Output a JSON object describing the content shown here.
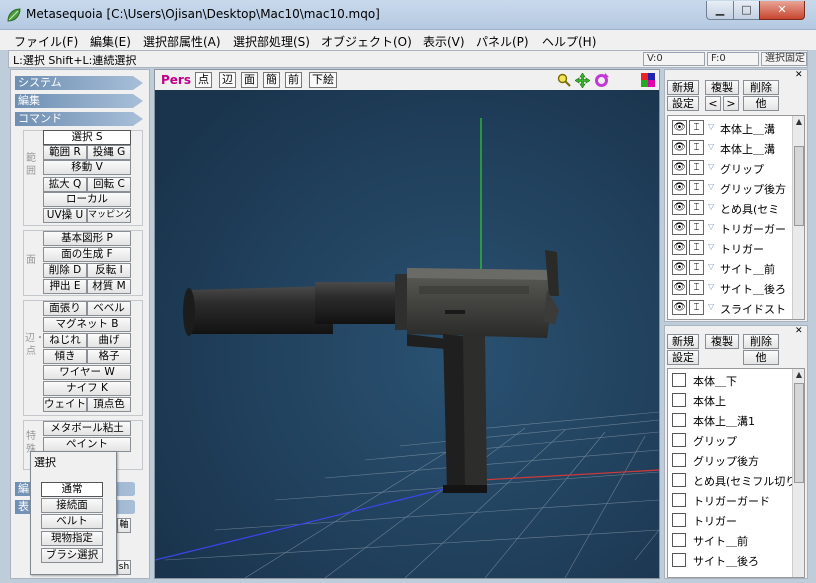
{
  "window": {
    "title": "Metasequoia [C:\\Users\\Ojisan\\Desktop\\Mac10\\mac10.mqo]",
    "min": "▁",
    "max": "□",
    "close": "✕"
  },
  "menu": [
    "ファイル(F)",
    "編集(E)",
    "選択部属性(A)",
    "選択部処理(S)",
    "オブジェクト(O)",
    "表示(V)",
    "パネル(P)",
    "ヘルプ(H)"
  ],
  "status": {
    "hint": "L:選択  Shift+L:連続選択",
    "v": "V:0",
    "f": "F:0",
    "fixed": "選択固定"
  },
  "left": {
    "sections": {
      "system": "システム",
      "edit": "編集",
      "command": "コマンド",
      "edit2": "編",
      "disp": "表"
    },
    "groups": {
      "g1": "範囲",
      "g2": "面",
      "g3": "辺・点",
      "g4": "特殊"
    },
    "btns": {
      "select": "選択 S",
      "range": "範囲 R",
      "lasso": "投縄 G",
      "move": "移動 V",
      "scale": "拡大 Q",
      "rotate": "回転 C",
      "local": "ローカル",
      "uv": "UV操 U",
      "mapping": "マッピング",
      "basic": "基本図形 P",
      "facegen": "面の生成 F",
      "delete": "削除 D",
      "invert": "反転 I",
      "extrude": "押出 E",
      "material": "材質 M",
      "stretch": "面張り",
      "bevel": "ベベル",
      "magnet": "マグネット B",
      "twist": "ねじれ",
      "bend": "曲げ",
      "tilt": "傾き",
      "lattice": "格子",
      "wire": "ワイヤー W",
      "knife": "ナイフ K",
      "weight": "ウェイト",
      "vcolor": "頂点色",
      "metaball": "メタボール粘土",
      "paint": "ペイント",
      "axis": "軸",
      "sh": "sh"
    }
  },
  "popup": {
    "title": "選択",
    "items": [
      "通常",
      "接続面",
      "ベルト",
      "現物指定",
      "ブラシ選択"
    ]
  },
  "viewport": {
    "mode": "Pers",
    "btns": [
      "点",
      "辺",
      "面",
      "簡",
      "前"
    ],
    "subdraw": "下絵",
    "icons": [
      "zoom-icon",
      "move-icon",
      "rotate-icon",
      "color-icon"
    ]
  },
  "objpanel": {
    "btns": {
      "new": "新規",
      "dup": "複製",
      "del": "削除",
      "set": "設定",
      "prev": "<",
      "next": ">",
      "other": "他"
    },
    "items": [
      "本体上＿溝",
      "本体上＿溝",
      "グリップ",
      "グリップ後方",
      "とめ具(セミ",
      "トリガーガー",
      "トリガー",
      "サイト＿前",
      "サイト＿後ろ",
      "スライドスト"
    ]
  },
  "matpanel": {
    "btns": {
      "new": "新規",
      "dup": "複製",
      "del": "削除",
      "set": "設定",
      "other": "他"
    },
    "items": [
      "本体＿下",
      "本体上",
      "本体上＿溝1",
      "グリップ",
      "グリップ後方",
      "とめ具(セミフル切り",
      "トリガーガード",
      "トリガー",
      "サイト＿前",
      "サイト＿後ろ"
    ]
  }
}
